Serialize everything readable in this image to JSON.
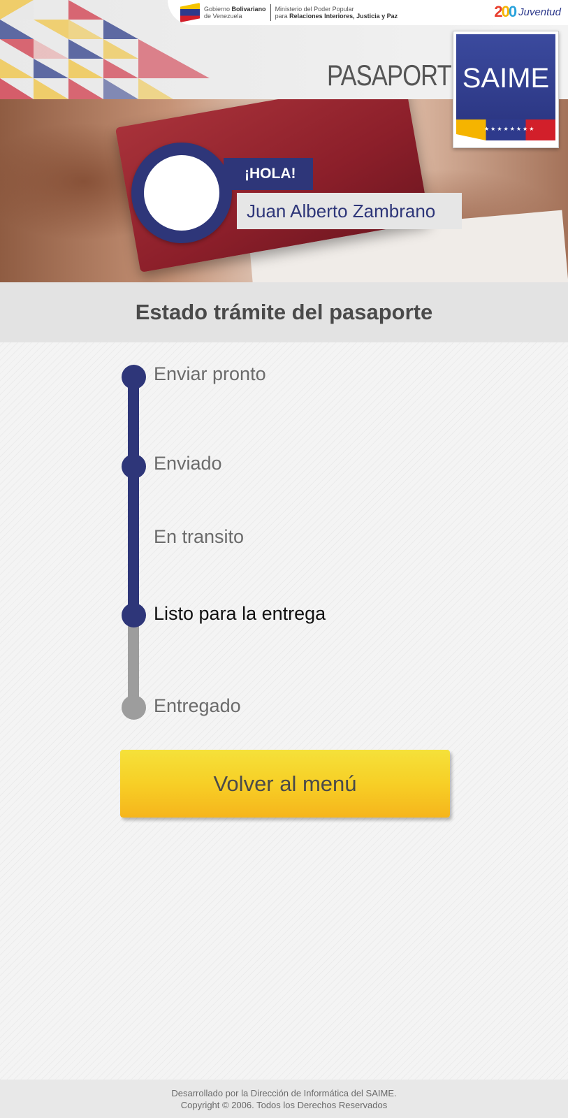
{
  "header": {
    "gov_line1_prefix": "Gobierno",
    "gov_line1_bold": "Bolivariano",
    "gov_line2": "de Venezuela",
    "ministry_line1": "Ministerio del Poder Popular",
    "ministry_line2_prefix": "para",
    "ministry_line2_bold": "Relaciones Interiores, Justicia y Paz",
    "juventud_number": [
      "2",
      "0",
      "0"
    ],
    "juventud_word": "Juventud",
    "section_title": "PASAPORTE",
    "brand": "SAIME",
    "brand_stars": "★★★★★★★★"
  },
  "greeting": {
    "hola": "¡HOLA!",
    "user_name": "Juan Alberto Zambrano"
  },
  "status": {
    "title": "Estado trámite del pasaporte",
    "steps": [
      {
        "label": "Enviar pronto",
        "state": "done"
      },
      {
        "label": "Enviado",
        "state": "done"
      },
      {
        "label": "En transito",
        "state": "done"
      },
      {
        "label": "Listo para la entrega",
        "state": "current"
      },
      {
        "label": "Entregado",
        "state": "pending"
      }
    ]
  },
  "actions": {
    "back_to_menu": "Volver al menú"
  },
  "footer": {
    "line1": "Desarrollado por la Dirección de Informática del SAIME.",
    "line2": "Copyright © 2006. Todos los Derechos Reservados"
  },
  "colors": {
    "primary": "#2e3679",
    "pending": "#9d9d9d",
    "button": "#f7cf26"
  }
}
